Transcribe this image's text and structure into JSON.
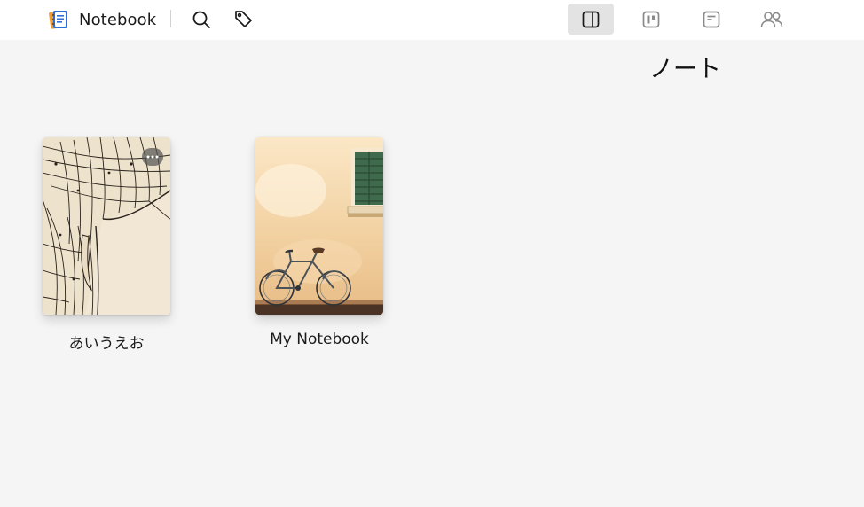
{
  "app": {
    "title": "Notebook",
    "icon": "notebook-app-icon"
  },
  "toolbar": {
    "search_icon": "search-icon",
    "tag_icon": "tag-icon"
  },
  "view_switcher": [
    {
      "id": "sidebar-view",
      "icon": "sidebar-panel-icon",
      "active": true
    },
    {
      "id": "board-view",
      "icon": "board-icon",
      "active": false
    },
    {
      "id": "note-view",
      "icon": "note-card-icon",
      "active": false
    },
    {
      "id": "shared-view",
      "icon": "people-icon",
      "active": false
    }
  ],
  "main": {
    "title": "ノート"
  },
  "notebooks": [
    {
      "label": "あいうえお",
      "cover": "elephant-zentangle-cover"
    },
    {
      "label": "My Notebook",
      "cover": "bicycle-watercolor-cover"
    }
  ]
}
